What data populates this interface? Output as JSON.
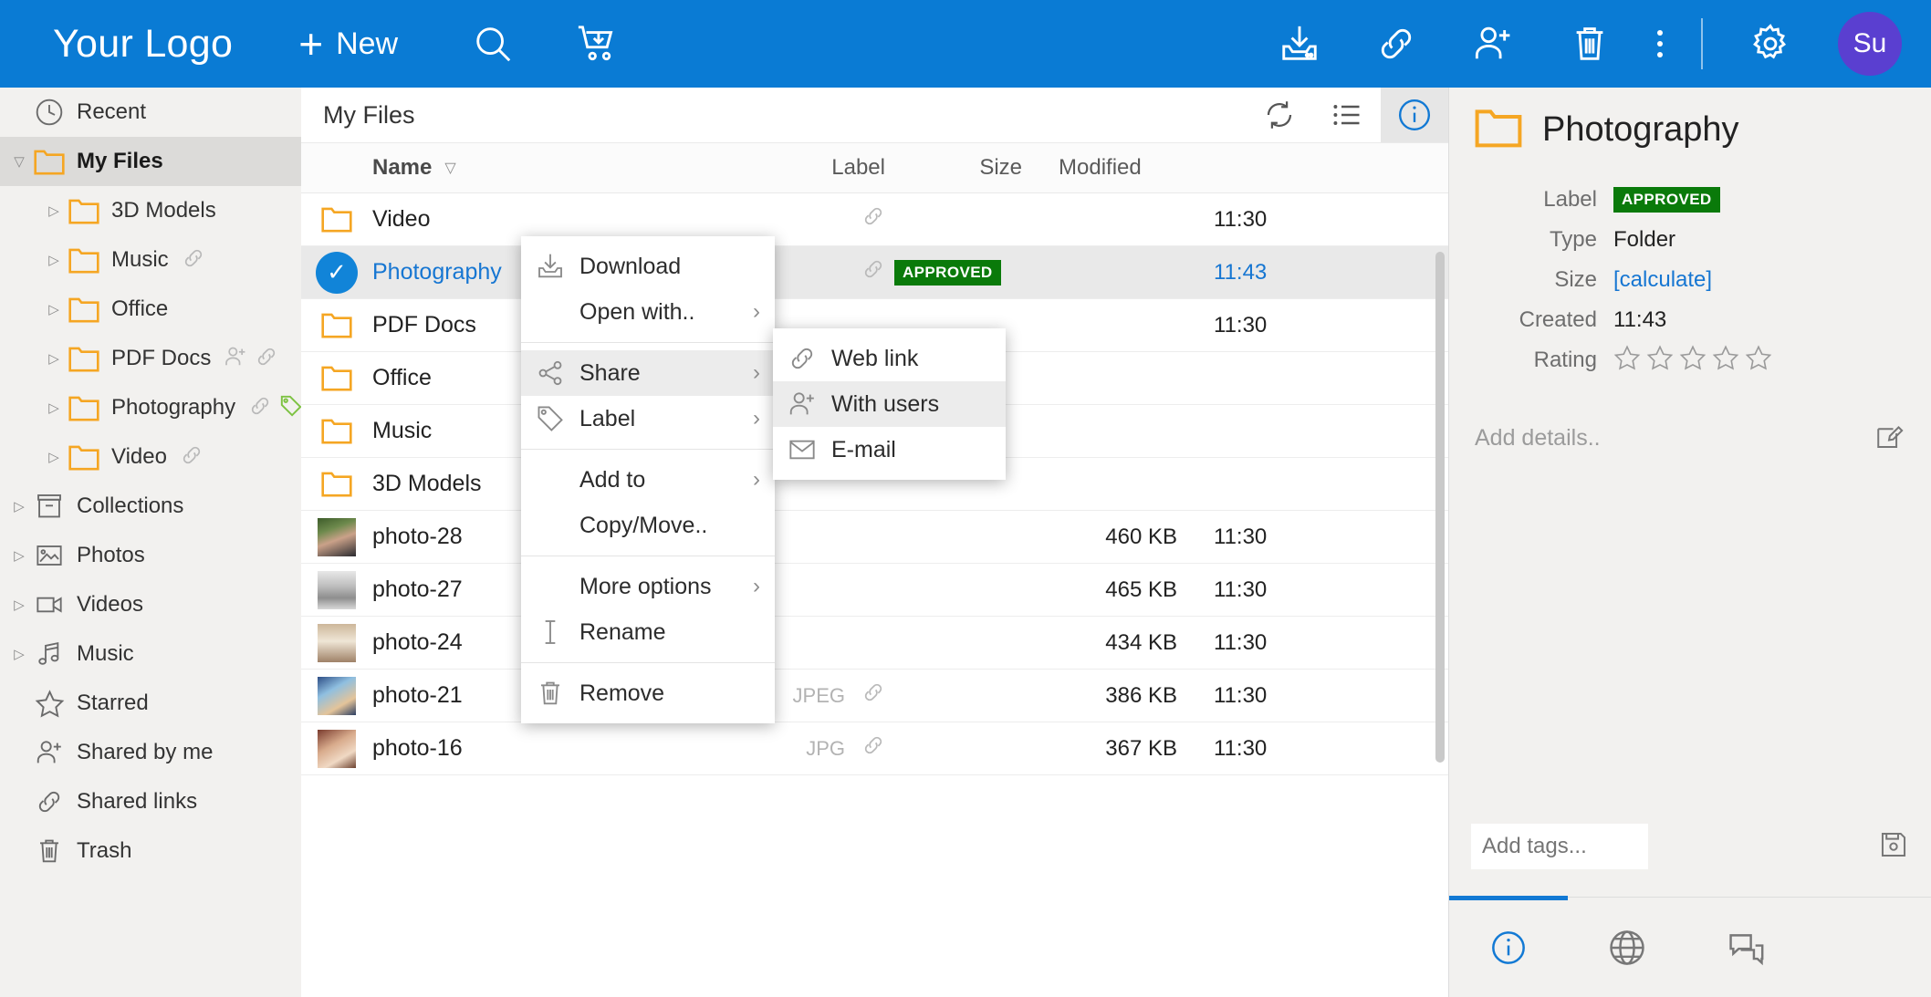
{
  "header": {
    "logo": "Your Logo",
    "new_label": "New",
    "avatar_initials": "Su",
    "icons": {
      "search": "search-icon",
      "cart": "cart-download-icon",
      "download": "download-icon",
      "link": "link-icon",
      "add_user": "add-user-icon",
      "trash": "trash-icon",
      "overflow": "more-vertical-icon",
      "settings": "gear-icon"
    }
  },
  "sidebar": {
    "items": [
      {
        "label": "Recent",
        "icon": "clock-icon",
        "level": 0,
        "caret": "none",
        "selected": false,
        "badges": []
      },
      {
        "label": "My Files",
        "icon": "folder-icon",
        "level": 0,
        "caret": "open",
        "selected": true,
        "badges": []
      },
      {
        "label": "3D Models",
        "icon": "folder-icon",
        "level": 1,
        "caret": "closed",
        "selected": false,
        "badges": []
      },
      {
        "label": "Music",
        "icon": "folder-icon",
        "level": 1,
        "caret": "closed",
        "selected": false,
        "badges": [
          "link"
        ]
      },
      {
        "label": "Office",
        "icon": "folder-icon",
        "level": 1,
        "caret": "closed",
        "selected": false,
        "badges": []
      },
      {
        "label": "PDF Docs",
        "icon": "folder-icon",
        "level": 1,
        "caret": "closed",
        "selected": false,
        "badges": [
          "user",
          "link"
        ]
      },
      {
        "label": "Photography",
        "icon": "folder-icon",
        "level": 1,
        "caret": "closed",
        "selected": false,
        "badges": [
          "link",
          "tag"
        ]
      },
      {
        "label": "Video",
        "icon": "folder-icon",
        "level": 1,
        "caret": "closed",
        "selected": false,
        "badges": [
          "link"
        ]
      },
      {
        "label": "Collections",
        "icon": "collections-icon",
        "level": 0,
        "caret": "closed",
        "selected": false,
        "badges": []
      },
      {
        "label": "Photos",
        "icon": "photos-icon",
        "level": 0,
        "caret": "closed",
        "selected": false,
        "badges": []
      },
      {
        "label": "Videos",
        "icon": "videos-icon",
        "level": 0,
        "caret": "closed",
        "selected": false,
        "badges": []
      },
      {
        "label": "Music",
        "icon": "music-icon",
        "level": 0,
        "caret": "closed",
        "selected": false,
        "badges": []
      },
      {
        "label": "Starred",
        "icon": "star-icon",
        "level": 0,
        "caret": "none",
        "selected": false,
        "badges": []
      },
      {
        "label": "Shared by me",
        "icon": "add-user-icon",
        "level": 0,
        "caret": "none",
        "selected": false,
        "badges": []
      },
      {
        "label": "Shared links",
        "icon": "link-icon",
        "level": 0,
        "caret": "none",
        "selected": false,
        "badges": []
      },
      {
        "label": "Trash",
        "icon": "trash-icon",
        "level": 0,
        "caret": "none",
        "selected": false,
        "badges": []
      }
    ]
  },
  "filepane": {
    "title": "My Files",
    "tools": [
      {
        "name": "refresh-icon",
        "active": false
      },
      {
        "name": "list-view-icon",
        "active": false
      },
      {
        "name": "info-icon",
        "active": true
      }
    ],
    "columns": {
      "name": "Name",
      "label": "Label",
      "size": "Size",
      "modified": "Modified"
    },
    "rows": [
      {
        "name": "Video",
        "kind": "folder",
        "type": "",
        "label": "",
        "size": "",
        "modified": "11:30",
        "shared": true,
        "selected": false
      },
      {
        "name": "Photography",
        "kind": "folder",
        "type": "",
        "label": "APPROVED",
        "size": "",
        "modified": "11:43",
        "shared": true,
        "selected": true
      },
      {
        "name": "PDF Docs",
        "kind": "folder",
        "type": "",
        "label": "",
        "size": "",
        "modified": "11:30",
        "shared": false,
        "selected": false
      },
      {
        "name": "Office",
        "kind": "folder",
        "type": "",
        "label": "",
        "size": "",
        "modified": "",
        "shared": false,
        "selected": false
      },
      {
        "name": "Music",
        "kind": "folder",
        "type": "",
        "label": "",
        "size": "",
        "modified": "",
        "shared": false,
        "selected": false
      },
      {
        "name": "3D Models",
        "kind": "folder",
        "type": "",
        "label": "",
        "size": "",
        "modified": "",
        "shared": false,
        "selected": false
      },
      {
        "name": "photo-28",
        "kind": "photo",
        "type": "",
        "label": "",
        "size": "460 KB",
        "modified": "11:30",
        "shared": false,
        "selected": false
      },
      {
        "name": "photo-27",
        "kind": "photo",
        "type": "",
        "label": "",
        "size": "465 KB",
        "modified": "11:30",
        "shared": false,
        "selected": false
      },
      {
        "name": "photo-24",
        "kind": "photo",
        "type": "",
        "label": "",
        "size": "434 KB",
        "modified": "11:30",
        "shared": false,
        "selected": false
      },
      {
        "name": "photo-21",
        "kind": "photo",
        "type": "JPEG",
        "label": "",
        "size": "386 KB",
        "modified": "11:30",
        "shared": true,
        "selected": false
      },
      {
        "name": "photo-16",
        "kind": "photo",
        "type": "JPG",
        "label": "",
        "size": "367 KB",
        "modified": "11:30",
        "shared": true,
        "selected": false
      }
    ]
  },
  "context_menu": {
    "items": [
      {
        "label": "Download",
        "icon": "download-icon",
        "arrow": false,
        "highlight": false,
        "sep_after": false
      },
      {
        "label": "Open with..",
        "icon": "",
        "arrow": true,
        "highlight": false,
        "sep_after": true
      },
      {
        "label": "Share",
        "icon": "share-icon",
        "arrow": true,
        "highlight": true,
        "sep_after": false
      },
      {
        "label": "Label",
        "icon": "tag-icon",
        "arrow": true,
        "highlight": false,
        "sep_after": true
      },
      {
        "label": "Add to",
        "icon": "",
        "arrow": true,
        "highlight": false,
        "sep_after": false
      },
      {
        "label": "Copy/Move..",
        "icon": "",
        "arrow": false,
        "highlight": false,
        "sep_after": true
      },
      {
        "label": "More options",
        "icon": "",
        "arrow": true,
        "highlight": false,
        "sep_after": false
      },
      {
        "label": "Rename",
        "icon": "cursor-icon",
        "arrow": false,
        "highlight": false,
        "sep_after": true
      },
      {
        "label": "Remove",
        "icon": "trash-icon",
        "arrow": false,
        "highlight": false,
        "sep_after": false
      }
    ]
  },
  "submenu": {
    "items": [
      {
        "label": "Web link",
        "icon": "link-icon",
        "highlight": false
      },
      {
        "label": "With users",
        "icon": "add-user-icon",
        "highlight": true
      },
      {
        "label": "E-mail",
        "icon": "mail-icon",
        "highlight": false
      }
    ]
  },
  "details": {
    "title": "Photography",
    "icon": "folder-icon",
    "properties": [
      {
        "key": "Label",
        "value": "APPROVED",
        "kind": "badge"
      },
      {
        "key": "Type",
        "value": "Folder",
        "kind": "text"
      },
      {
        "key": "Size",
        "value": "[calculate]",
        "kind": "link"
      },
      {
        "key": "Created",
        "value": "11:43",
        "kind": "text"
      },
      {
        "key": "Rating",
        "value": "",
        "kind": "stars"
      }
    ],
    "rating": 0,
    "rating_max": 5,
    "add_details_placeholder": "Add details..",
    "add_tags_placeholder": "Add tags...",
    "tabs": [
      {
        "name": "info-icon",
        "active": true
      },
      {
        "name": "globe-icon",
        "active": false
      },
      {
        "name": "comments-icon",
        "active": false
      }
    ]
  },
  "colors": {
    "brand_blue": "#0a7bd4",
    "folder_orange": "#F5A623",
    "approved_green": "#0a7a0a",
    "selected_text": "#1676d2",
    "avatar_purple": "#5a3fd0"
  }
}
